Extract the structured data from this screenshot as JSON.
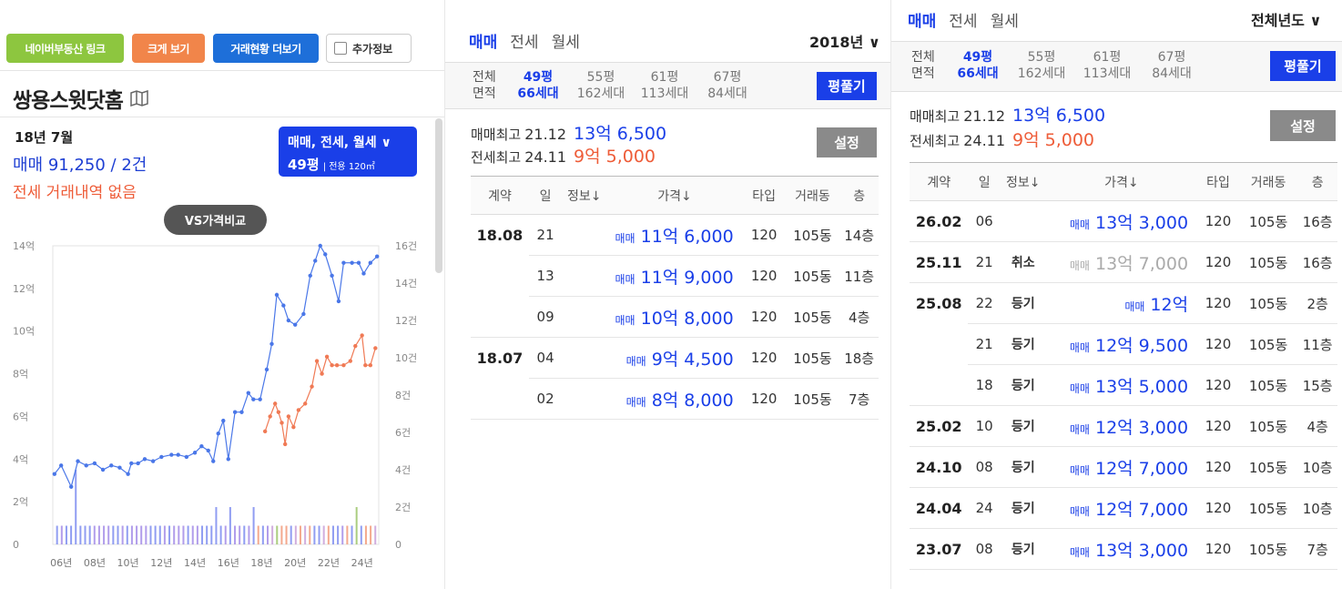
{
  "panel1": {
    "buttons": {
      "naver_link": "네이버부동산 링크",
      "enlarge": "크게 보기",
      "more_deals": "거래현황 더보기",
      "extra_info": "추가정보"
    },
    "apt_name": "쌍용스윗닷홈",
    "stat_date": "18년 7월",
    "stat_sale": "매매 91,250 / 2건",
    "stat_jeonse": "전세 거래내역 없음",
    "type_selector": {
      "line1": "매매, 전세, 월세",
      "line2": "49평",
      "line2_sub": "| 전용 120㎡"
    },
    "vs_button": "VS가격비교",
    "colors": {
      "sale": "#4a77e8",
      "jeonse": "#f07a55",
      "accent": "#1a3fe8"
    }
  },
  "chart_data": {
    "type": "line",
    "x_ticks": [
      "06년",
      "08년",
      "10년",
      "12년",
      "14년",
      "16년",
      "18년",
      "20년",
      "22년",
      "24년"
    ],
    "y_left_ticks": [
      "0",
      "2억",
      "4억",
      "6억",
      "8억",
      "10억",
      "12억",
      "14억"
    ],
    "y_right_ticks": [
      "0",
      "2건",
      "4건",
      "6건",
      "8건",
      "10건",
      "12건",
      "14건",
      "16건"
    ],
    "ylim_left": [
      0,
      14
    ],
    "ylim_right": [
      0,
      16
    ],
    "xlim": [
      2005.5,
      2025.0
    ],
    "series": [
      {
        "kind": "sale",
        "color": "#4a77e8",
        "points": [
          [
            2005.6,
            3.3
          ],
          [
            2006.0,
            3.7
          ],
          [
            2006.6,
            2.7
          ],
          [
            2007.0,
            3.9
          ],
          [
            2007.5,
            3.7
          ],
          [
            2008.0,
            3.8
          ],
          [
            2008.5,
            3.5
          ],
          [
            2009.0,
            3.7
          ],
          [
            2009.5,
            3.6
          ],
          [
            2010.0,
            3.3
          ],
          [
            2010.2,
            3.8
          ],
          [
            2010.6,
            3.8
          ],
          [
            2011.0,
            4.0
          ],
          [
            2011.5,
            3.9
          ],
          [
            2012.0,
            4.1
          ],
          [
            2012.6,
            4.2
          ],
          [
            2013.0,
            4.2
          ],
          [
            2013.5,
            4.1
          ],
          [
            2014.0,
            4.3
          ],
          [
            2014.4,
            4.6
          ],
          [
            2014.8,
            4.4
          ],
          [
            2015.1,
            3.9
          ],
          [
            2015.4,
            5.2
          ],
          [
            2015.7,
            5.8
          ],
          [
            2016.0,
            4.0
          ],
          [
            2016.4,
            6.2
          ],
          [
            2016.8,
            6.2
          ],
          [
            2017.2,
            7.1
          ],
          [
            2017.5,
            6.8
          ],
          [
            2017.9,
            6.8
          ],
          [
            2018.3,
            8.2
          ],
          [
            2018.6,
            9.4
          ],
          [
            2018.9,
            11.7
          ],
          [
            2019.3,
            11.2
          ],
          [
            2019.6,
            10.5
          ],
          [
            2020.0,
            10.3
          ],
          [
            2020.5,
            10.8
          ],
          [
            2020.9,
            12.6
          ],
          [
            2021.2,
            13.3
          ],
          [
            2021.5,
            14.0
          ],
          [
            2021.8,
            13.6
          ],
          [
            2022.2,
            12.6
          ],
          [
            2022.6,
            11.4
          ],
          [
            2022.9,
            13.2
          ],
          [
            2023.4,
            13.2
          ],
          [
            2023.8,
            13.2
          ],
          [
            2024.1,
            12.7
          ],
          [
            2024.5,
            13.2
          ],
          [
            2024.9,
            13.5
          ]
        ]
      },
      {
        "kind": "jeonse",
        "color": "#f07a55",
        "points": [
          [
            2018.2,
            5.3
          ],
          [
            2018.5,
            6.0
          ],
          [
            2018.8,
            6.6
          ],
          [
            2019.0,
            6.2
          ],
          [
            2019.2,
            5.7
          ],
          [
            2019.4,
            4.7
          ],
          [
            2019.6,
            6.0
          ],
          [
            2019.9,
            5.5
          ],
          [
            2020.2,
            6.3
          ],
          [
            2020.6,
            6.6
          ],
          [
            2021.0,
            7.4
          ],
          [
            2021.3,
            8.6
          ],
          [
            2021.6,
            8.0
          ],
          [
            2021.9,
            8.8
          ],
          [
            2022.2,
            8.4
          ],
          [
            2022.5,
            8.4
          ],
          [
            2022.9,
            8.4
          ],
          [
            2023.3,
            8.6
          ],
          [
            2023.6,
            9.3
          ],
          [
            2024.0,
            9.8
          ],
          [
            2024.2,
            8.4
          ],
          [
            2024.5,
            8.4
          ],
          [
            2024.8,
            9.2
          ]
        ]
      }
    ]
  },
  "panel2": {
    "tabs": [
      "매매",
      "전세",
      "월세"
    ],
    "active_tab": 0,
    "year": "2018년",
    "size_cols": [
      {
        "l1": "전체",
        "l2": "면적",
        "selected": false
      },
      {
        "l1": "49평",
        "l2": "66세대",
        "selected": true
      },
      {
        "l1": "55평",
        "l2": "162세대",
        "selected": false
      },
      {
        "l1": "61평",
        "l2": "113세대",
        "selected": false
      },
      {
        "l1": "67평",
        "l2": "84세대",
        "selected": false
      }
    ],
    "pyeong_btn": "평풀기",
    "settings_btn": "설정",
    "max_sale_label": "매매최고",
    "max_sale_ym": "21.12",
    "max_sale_price": "13억 6,500",
    "max_jeonse_label": "전세최고",
    "max_jeonse_ym": "24.11",
    "max_jeonse_price": "9억 5,000",
    "headers": [
      "계약",
      "일",
      "정보↓",
      "가격↓",
      "타입",
      "거래동",
      "층"
    ],
    "rows": [
      {
        "date": "18.08",
        "day": "21",
        "info": "",
        "kind": "매매",
        "price": "11억 6,000",
        "type": "120",
        "dong": "105동",
        "floor": "14층"
      },
      {
        "date": "",
        "day": "13",
        "info": "",
        "kind": "매매",
        "price": "11억 9,000",
        "type": "120",
        "dong": "105동",
        "floor": "11층"
      },
      {
        "date": "",
        "day": "09",
        "info": "",
        "kind": "매매",
        "price": "10억 8,000",
        "type": "120",
        "dong": "105동",
        "floor": "4층"
      },
      {
        "date": "18.07",
        "day": "04",
        "info": "",
        "kind": "매매",
        "price": "9억 4,500",
        "type": "120",
        "dong": "105동",
        "floor": "18층"
      },
      {
        "date": "",
        "day": "02",
        "info": "",
        "kind": "매매",
        "price": "8억 8,000",
        "type": "120",
        "dong": "105동",
        "floor": "7층"
      }
    ]
  },
  "panel3": {
    "tabs": [
      "매매",
      "전세",
      "월세"
    ],
    "active_tab": 0,
    "year": "전체년도",
    "size_cols": [
      {
        "l1": "전체",
        "l2": "면적",
        "selected": false
      },
      {
        "l1": "49평",
        "l2": "66세대",
        "selected": true
      },
      {
        "l1": "55평",
        "l2": "162세대",
        "selected": false
      },
      {
        "l1": "61평",
        "l2": "113세대",
        "selected": false
      },
      {
        "l1": "67평",
        "l2": "84세대",
        "selected": false
      }
    ],
    "pyeong_btn": "평풀기",
    "settings_btn": "설정",
    "max_sale_label": "매매최고",
    "max_sale_ym": "21.12",
    "max_sale_price": "13억 6,500",
    "max_jeonse_label": "전세최고",
    "max_jeonse_ym": "24.11",
    "max_jeonse_price": "9억 5,000",
    "headers": [
      "계약",
      "일",
      "정보↓",
      "가격↓",
      "타입",
      "거래동",
      "층"
    ],
    "rows": [
      {
        "date": "26.02",
        "day": "06",
        "info": "",
        "kind": "매매",
        "price": "13억 3,000",
        "type": "120",
        "dong": "105동",
        "floor": "16층",
        "cancel": false
      },
      {
        "date": "25.11",
        "day": "21",
        "info": "취소",
        "kind": "매매",
        "price": "13억 7,000",
        "type": "120",
        "dong": "105동",
        "floor": "16층",
        "cancel": true
      },
      {
        "date": "25.08",
        "day": "22",
        "info": "등기",
        "kind": "매매",
        "price": "12억",
        "type": "120",
        "dong": "105동",
        "floor": "2층",
        "cancel": false
      },
      {
        "date": "",
        "day": "21",
        "info": "등기",
        "kind": "매매",
        "price": "12억 9,500",
        "type": "120",
        "dong": "105동",
        "floor": "11층",
        "cancel": false
      },
      {
        "date": "",
        "day": "18",
        "info": "등기",
        "kind": "매매",
        "price": "13억 5,000",
        "type": "120",
        "dong": "105동",
        "floor": "15층",
        "cancel": false
      },
      {
        "date": "25.02",
        "day": "10",
        "info": "등기",
        "kind": "매매",
        "price": "12억 3,000",
        "type": "120",
        "dong": "105동",
        "floor": "4층",
        "cancel": false
      },
      {
        "date": "24.10",
        "day": "08",
        "info": "등기",
        "kind": "매매",
        "price": "12억 7,000",
        "type": "120",
        "dong": "105동",
        "floor": "10층",
        "cancel": false
      },
      {
        "date": "24.04",
        "day": "24",
        "info": "등기",
        "kind": "매매",
        "price": "12억 7,000",
        "type": "120",
        "dong": "105동",
        "floor": "10층",
        "cancel": false
      },
      {
        "date": "23.07",
        "day": "08",
        "info": "등기",
        "kind": "매매",
        "price": "13억 3,000",
        "type": "120",
        "dong": "105동",
        "floor": "7층",
        "cancel": false
      }
    ]
  }
}
